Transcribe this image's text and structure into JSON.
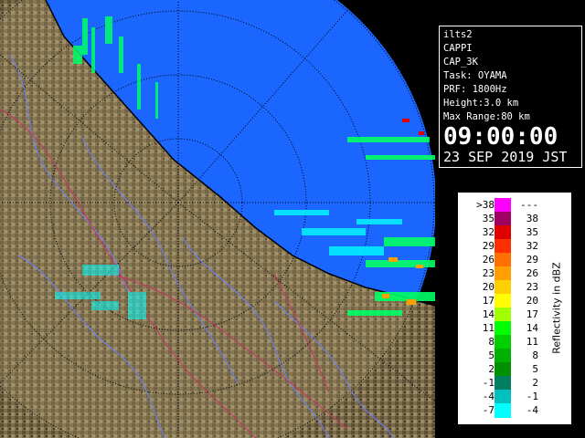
{
  "info": {
    "radar": "ilts2",
    "product": "CAPPI",
    "product_code": "CAP_3K",
    "task": "Task: OYAMA",
    "prf": "PRF: 1800Hz",
    "height": "Height:3.0 km",
    "max_range": "Max Range:80 km",
    "time": "09:00:00",
    "date": "23 SEP 2019 JST"
  },
  "legend": {
    "title": "Reflectivity in dBZ",
    "rows": [
      {
        "lo": ">38",
        "hi": "---",
        "color": "#ff00ff"
      },
      {
        "lo": "35",
        "hi": "38",
        "color": "#a00060"
      },
      {
        "lo": "32",
        "hi": "35",
        "color": "#e00000"
      },
      {
        "lo": "29",
        "hi": "32",
        "color": "#ff3000"
      },
      {
        "lo": "26",
        "hi": "29",
        "color": "#ff7000"
      },
      {
        "lo": "23",
        "hi": "26",
        "color": "#ffa000"
      },
      {
        "lo": "20",
        "hi": "23",
        "color": "#ffd000"
      },
      {
        "lo": "17",
        "hi": "20",
        "color": "#ffff00"
      },
      {
        "lo": "14",
        "hi": "17",
        "color": "#a0ff00"
      },
      {
        "lo": "11",
        "hi": "14",
        "color": "#00ff00"
      },
      {
        "lo": "8",
        "hi": "11",
        "color": "#00d000"
      },
      {
        "lo": "5",
        "hi": "8",
        "color": "#00b000"
      },
      {
        "lo": "2",
        "hi": "5",
        "color": "#009000"
      },
      {
        "lo": "-1",
        "hi": "2",
        "color": "#008060"
      },
      {
        "lo": "-4",
        "hi": "-1",
        "color": "#00c0c0"
      },
      {
        "lo": "-7",
        "hi": "-4",
        "color": "#00ffff"
      }
    ]
  },
  "colors": {
    "sea": "#1a66ff",
    "land": "#7a6a4a",
    "river": "#6a80ff",
    "border": "#cc3366",
    "echo_light": "#00ffff",
    "echo_green": "#00ff66"
  }
}
